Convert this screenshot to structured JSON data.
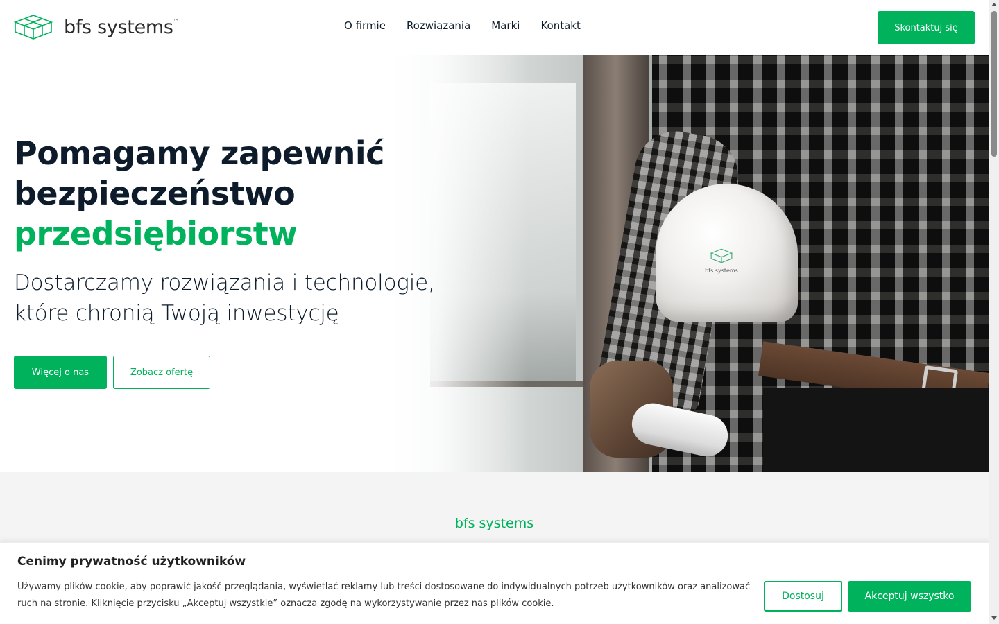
{
  "header": {
    "logo_text": "bfs systems",
    "logo_tm": "™",
    "nav": [
      {
        "label": "O firmie"
      },
      {
        "label": "Rozwiązania"
      },
      {
        "label": "Marki"
      },
      {
        "label": "Kontakt"
      }
    ],
    "cta_label": "Skontaktuj się"
  },
  "hero": {
    "title_line1": "Pomagamy zapewnić",
    "title_line2": "bezpieczeństwo",
    "title_line3": "przedsiębiorstw",
    "subtitle_line1": "Dostarczamy rozwiązania i technologie,",
    "subtitle_line2": "które chronią Twoją inwestycję",
    "primary_button": "Więcej o nas",
    "secondary_button": "Zobacz ofertę",
    "image_helmet_text": "bfs systems"
  },
  "section": {
    "eyebrow": "bfs systems"
  },
  "cookie": {
    "title": "Cenimy prywatność użytkowników",
    "text": "Używamy plików cookie, aby poprawić jakość przeglądania, wyświetlać reklamy lub treści dostosowane do indywidualnych potrzeb użytkowników oraz analizować ruch na stronie. Kliknięcie przycisku „Akceptuj wszystkie” oznacza zgodę na wykorzystywanie przez nas plików cookie.",
    "customize_button": "Dostosuj",
    "accept_button": "Akceptuj wszystko"
  },
  "colors": {
    "accent": "#00b25c",
    "heading": "#0d1b2a",
    "section_bg": "#f4f4f4"
  }
}
